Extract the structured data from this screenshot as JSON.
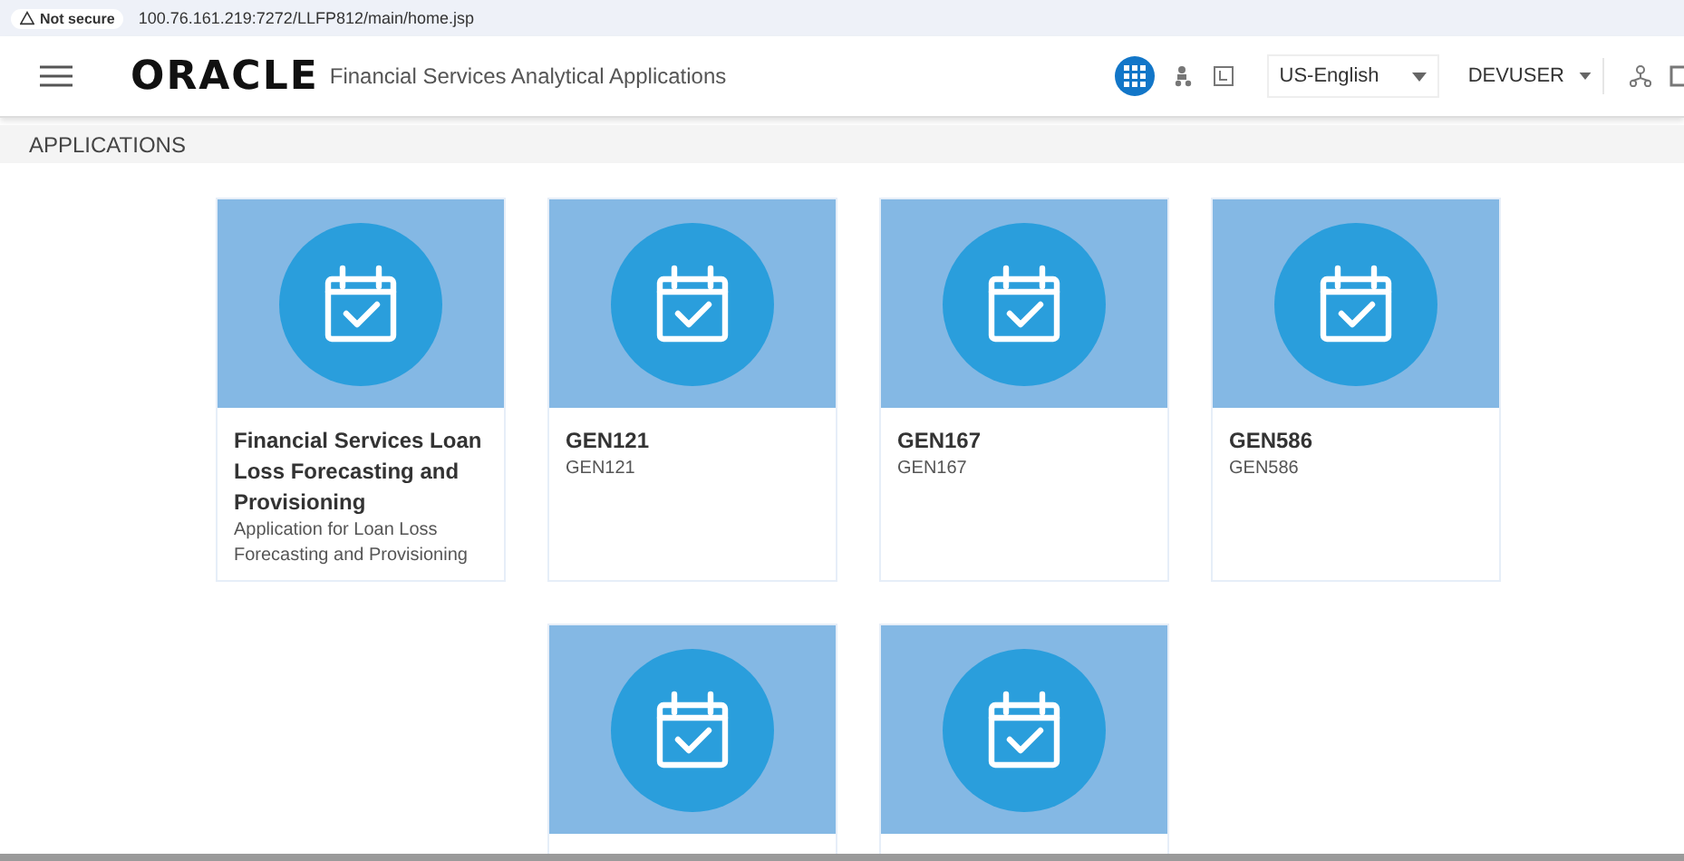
{
  "address_bar": {
    "security": "Not secure",
    "url": "100.76.161.219:7272/LLFP812/main/home.jsp"
  },
  "header": {
    "logo": "ORACLE",
    "product": "Financial Services Analytical Applications",
    "language": "US-English",
    "user": "DEVUSER"
  },
  "section": {
    "title": "APPLICATIONS"
  },
  "cards": [
    {
      "kind": "full",
      "title": "Financial Services Loan Loss Forecasting and Provisioning",
      "description": "Application for Loan Loss Forecasting and Provisioning"
    },
    {
      "kind": "full",
      "title": "GEN121",
      "description": "GEN121"
    },
    {
      "kind": "full",
      "title": "GEN167",
      "description": "GEN167"
    },
    {
      "kind": "full",
      "title": "GEN586",
      "description": "GEN586"
    },
    {
      "kind": "cut"
    },
    {
      "kind": "cut"
    }
  ]
}
